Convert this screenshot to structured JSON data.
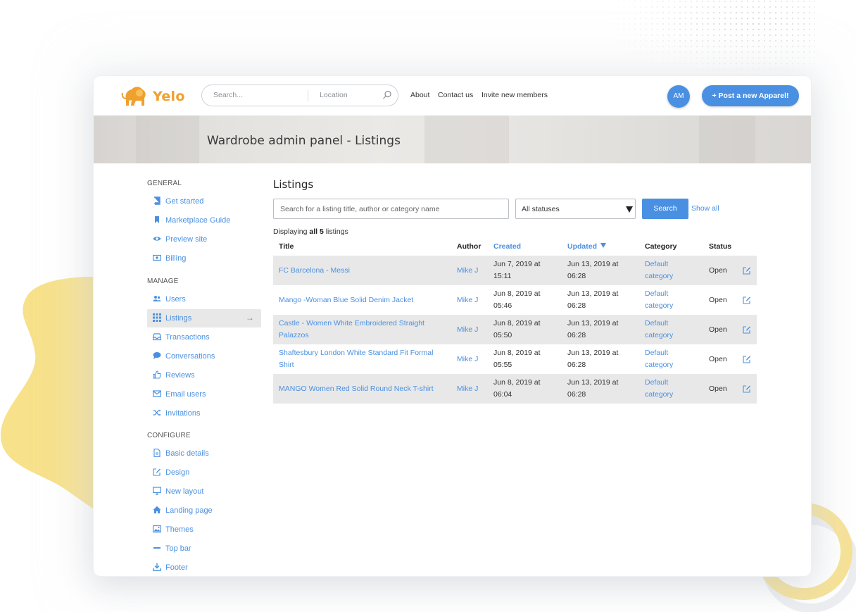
{
  "header": {
    "brand": "Yelo",
    "search_placeholder": "Search...",
    "location_placeholder": "Location",
    "nav": [
      "About",
      "Contact us",
      "Invite new members"
    ],
    "avatar_initials": "AM",
    "post_button": "+ Post a new Apparel!"
  },
  "hero": {
    "title": "Wardrobe admin panel - Listings"
  },
  "sidebar": {
    "sections": [
      {
        "label": "GENERAL",
        "items": [
          {
            "label": "Get started",
            "icon": "book-icon"
          },
          {
            "label": "Marketplace Guide",
            "icon": "bookmark-icon"
          },
          {
            "label": "Preview site",
            "icon": "eye-icon"
          },
          {
            "label": "Billing",
            "icon": "money-icon"
          }
        ]
      },
      {
        "label": "MANAGE",
        "items": [
          {
            "label": "Users",
            "icon": "users-icon"
          },
          {
            "label": "Listings",
            "icon": "grid-icon",
            "active": true
          },
          {
            "label": "Transactions",
            "icon": "inbox-icon"
          },
          {
            "label": "Conversations",
            "icon": "chat-icon"
          },
          {
            "label": "Reviews",
            "icon": "thumbs-up-icon"
          },
          {
            "label": "Email users",
            "icon": "envelope-icon"
          },
          {
            "label": "Invitations",
            "icon": "shuffle-icon"
          }
        ]
      },
      {
        "label": "CONFIGURE",
        "items": [
          {
            "label": "Basic details",
            "icon": "file-icon"
          },
          {
            "label": "Design",
            "icon": "pencil-square-icon"
          },
          {
            "label": "New layout",
            "icon": "monitor-icon"
          },
          {
            "label": "Landing page",
            "icon": "home-icon"
          },
          {
            "label": "Themes",
            "icon": "image-icon"
          },
          {
            "label": "Top bar",
            "icon": "minus-icon"
          },
          {
            "label": "Footer",
            "icon": "download-icon"
          }
        ]
      }
    ]
  },
  "listings": {
    "heading": "Listings",
    "search_placeholder": "Search for a listing title, author or category name",
    "status_filter": "All statuses",
    "search_button": "Search",
    "show_all": "Show all",
    "display_prefix": "Displaying ",
    "display_bold": "all 5",
    "display_suffix": " listings",
    "columns": [
      "Title",
      "Author",
      "Created",
      "Updated",
      "Category",
      "Status"
    ],
    "rows": [
      {
        "title": [
          "FC Barcelona - Messi"
        ],
        "author": "Mike J",
        "created": [
          "Jun 7, 2019 at",
          "15:11"
        ],
        "updated": [
          "Jun 13, 2019 at",
          "06:28"
        ],
        "category": [
          "Default",
          "category"
        ],
        "status": "Open"
      },
      {
        "title": [
          "Mango -Woman Blue Solid Denim Jacket"
        ],
        "author": "Mike J",
        "created": [
          "Jun 8, 2019 at",
          "05:46"
        ],
        "updated": [
          "Jun 13, 2019 at",
          "06:28"
        ],
        "category": [
          "Default",
          "category"
        ],
        "status": "Open"
      },
      {
        "title": [
          "Castle - Women White Embroidered Straight",
          "Palazzos"
        ],
        "author": "Mike J",
        "created": [
          "Jun 8, 2019 at",
          "05:50"
        ],
        "updated": [
          "Jun 13, 2019 at",
          "06:28"
        ],
        "category": [
          "Default",
          "category"
        ],
        "status": "Open"
      },
      {
        "title": [
          "Shaftesbury London White Standard Fit Formal",
          "Shirt"
        ],
        "author": "Mike J",
        "created": [
          "Jun 8, 2019 at",
          "05:55"
        ],
        "updated": [
          "Jun 13, 2019 at",
          "06:28"
        ],
        "category": [
          "Default",
          "category"
        ],
        "status": "Open"
      },
      {
        "title": [
          "MANGO Women Red Solid Round Neck T-shirt"
        ],
        "author": "Mike J",
        "created": [
          "Jun 8, 2019 at",
          "06:04"
        ],
        "updated": [
          "Jun 13, 2019 at",
          "06:28"
        ],
        "category": [
          "Default",
          "category"
        ],
        "status": "Open"
      }
    ]
  },
  "colors": {
    "accent": "#4a90e2",
    "brand": "#f0a02e",
    "row_shade": "#e8e8e8",
    "blob": "#f7e18a"
  }
}
